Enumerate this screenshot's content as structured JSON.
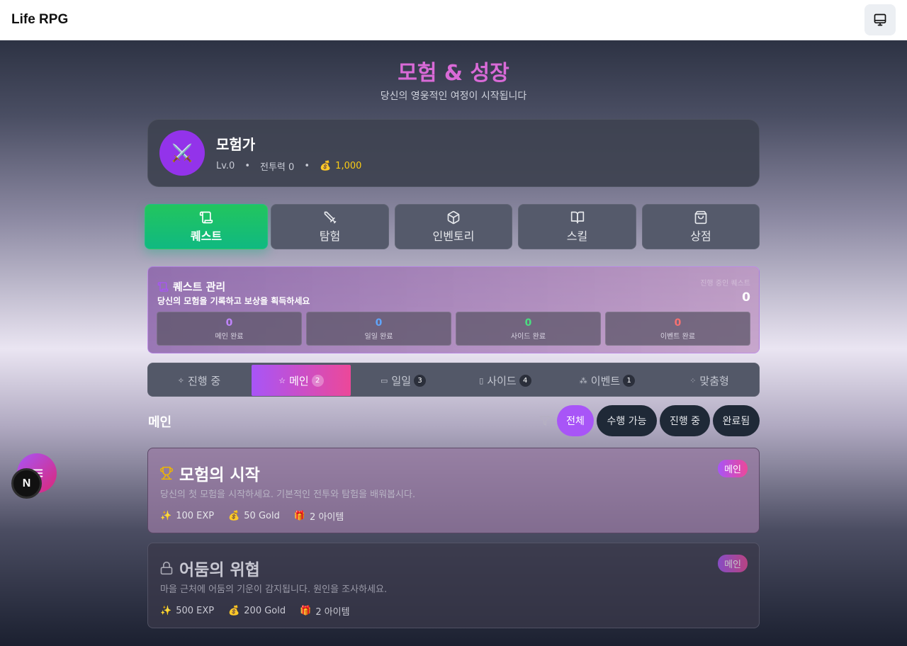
{
  "app": {
    "title": "Life RPG"
  },
  "hero": {
    "title": "모험 & 성장",
    "subtitle": "당신의 영웅적인 여정이 시작됩니다"
  },
  "profile": {
    "avatar_icon": "crossed-swords-icon",
    "name": "모험가",
    "level": "Lv.0",
    "power": "전투력 0",
    "gold": "1,000"
  },
  "main_tabs": [
    {
      "label": "퀘스트",
      "icon": "scroll-icon",
      "active": true
    },
    {
      "label": "탐험",
      "icon": "sword-icon"
    },
    {
      "label": "인벤토리",
      "icon": "box-icon"
    },
    {
      "label": "스킬",
      "icon": "book-icon"
    },
    {
      "label": "상점",
      "icon": "shopping-bag-icon"
    }
  ],
  "quest_panel": {
    "title": "퀘스트 관리",
    "subtitle": "당신의 모험을 기록하고 보상을 획득하세요",
    "in_progress_label": "진행 중인 퀘스트",
    "in_progress_value": "0",
    "stats": [
      {
        "value": "0",
        "label": "메인 완료",
        "color": "#c084fc"
      },
      {
        "value": "0",
        "label": "일일 완료",
        "color": "#60a5fa"
      },
      {
        "value": "0",
        "label": "사이드 완료",
        "color": "#4ade80"
      },
      {
        "value": "0",
        "label": "이벤트 완료",
        "color": "#f87171"
      }
    ]
  },
  "sub_tabs": [
    {
      "label": "진행 중",
      "icon": "✧"
    },
    {
      "label": "메인",
      "icon": "☆",
      "count": "2",
      "active": true
    },
    {
      "label": "일일",
      "icon": "▭",
      "count": "3"
    },
    {
      "label": "사이드",
      "icon": "▯",
      "count": "4"
    },
    {
      "label": "이벤트",
      "icon": "⁂",
      "count": "1"
    },
    {
      "label": "맞춤형",
      "icon": "⁘"
    }
  ],
  "section": {
    "title": "메인"
  },
  "filters": [
    {
      "label": "전체",
      "active": true
    },
    {
      "label": "수행 가능"
    },
    {
      "label": "진행 중"
    },
    {
      "label": "완료됨"
    }
  ],
  "quests": [
    {
      "title": "모험의 시작",
      "description": "당신의 첫 모험을 시작하세요. 기본적인 전투와 탐험을 배워봅시다.",
      "exp": "100 EXP",
      "gold": "50 Gold",
      "items": "2 아이템",
      "badge": "메인",
      "icon": "trophy-icon"
    },
    {
      "title": "어둠의 위협",
      "description": "마을 근처에 어둠의 기운이 감지됩니다. 원인을 조사하세요.",
      "exp": "500 EXP",
      "gold": "200 Gold",
      "items": "2 아이템",
      "badge": "메인",
      "icon": "lock-icon"
    }
  ],
  "fab": {
    "icon": "menu-icon",
    "badge": "N"
  }
}
